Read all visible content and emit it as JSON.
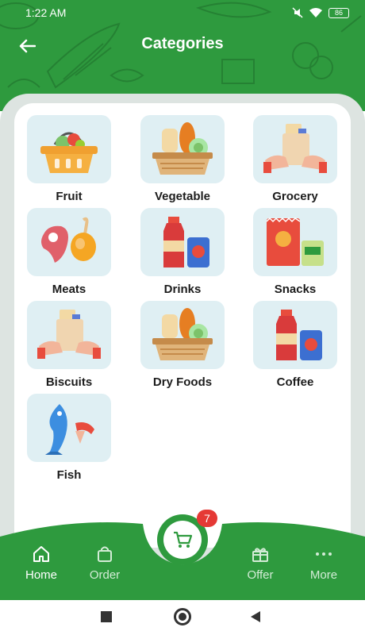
{
  "status_bar": {
    "time": "1:22 AM",
    "battery": "86"
  },
  "header": {
    "title": "Categories"
  },
  "categories": [
    {
      "label": "Fruit",
      "icon": "fruit-basket-icon"
    },
    {
      "label": "Vegetable",
      "icon": "bread-basket-icon"
    },
    {
      "label": "Grocery",
      "icon": "grocery-bag-icon"
    },
    {
      "label": "Meats",
      "icon": "meat-icon"
    },
    {
      "label": "Drinks",
      "icon": "drinks-icon"
    },
    {
      "label": "Snacks",
      "icon": "snacks-icon"
    },
    {
      "label": "Biscuits",
      "icon": "grocery-bag-icon"
    },
    {
      "label": "Dry Foods",
      "icon": "bread-basket-icon"
    },
    {
      "label": "Coffee",
      "icon": "drinks-icon"
    },
    {
      "label": "Fish",
      "icon": "fish-icon"
    }
  ],
  "bottom_nav": {
    "items": [
      {
        "label": "Home",
        "icon": "home-icon",
        "active": true
      },
      {
        "label": "Order",
        "icon": "shopping-bag-icon",
        "active": false
      },
      {
        "label": "Offer",
        "icon": "gift-icon",
        "active": false
      },
      {
        "label": "More",
        "icon": "more-dots-icon",
        "active": false
      }
    ],
    "cart_badge": "7"
  },
  "colors": {
    "brand_green": "#2e9a3e",
    "tile_bg": "#dfeff3",
    "badge_red": "#e53935"
  }
}
